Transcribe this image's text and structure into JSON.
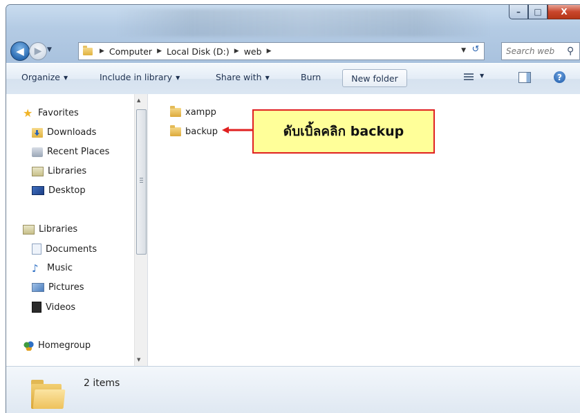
{
  "window": {
    "controls": {
      "minimize": "–",
      "maximize": "□",
      "close": "X"
    }
  },
  "nav": {
    "back_glyph": "◀",
    "forward_glyph": "▶",
    "history_glyph": "▼",
    "breadcrumbs": [
      "Computer",
      "Local Disk (D:)",
      "web"
    ],
    "separator": "▶",
    "refresh_glyph": "↺",
    "search_placeholder": "Search web",
    "search_icon": "magnifier-icon"
  },
  "toolbar": {
    "organize": "Organize",
    "include_in_library": "Include in library",
    "share_with": "Share with",
    "burn": "Burn",
    "new_folder": "New folder",
    "caret": "▼",
    "help": "?"
  },
  "sidebar": {
    "favorites": {
      "header": "Favorites",
      "items": [
        {
          "label": "Downloads",
          "icon": "downloads-icon"
        },
        {
          "label": "Recent Places",
          "icon": "recent-places-icon"
        },
        {
          "label": "Libraries",
          "icon": "libraries-icon"
        },
        {
          "label": "Desktop",
          "icon": "desktop-icon"
        }
      ]
    },
    "libraries": {
      "header": "Libraries",
      "items": [
        {
          "label": "Documents",
          "icon": "documents-icon"
        },
        {
          "label": "Music",
          "icon": "music-icon"
        },
        {
          "label": "Pictures",
          "icon": "pictures-icon"
        },
        {
          "label": "Videos",
          "icon": "videos-icon"
        }
      ]
    },
    "homegroup": "Homegroup"
  },
  "files": [
    {
      "name": "xampp",
      "type": "folder"
    },
    {
      "name": "backup",
      "type": "folder"
    }
  ],
  "annotation": {
    "text": "ดับเบิ้ลคลิก backup",
    "border_color": "#e02020",
    "fill_color": "#ffff99"
  },
  "details": {
    "count": "2 items"
  }
}
